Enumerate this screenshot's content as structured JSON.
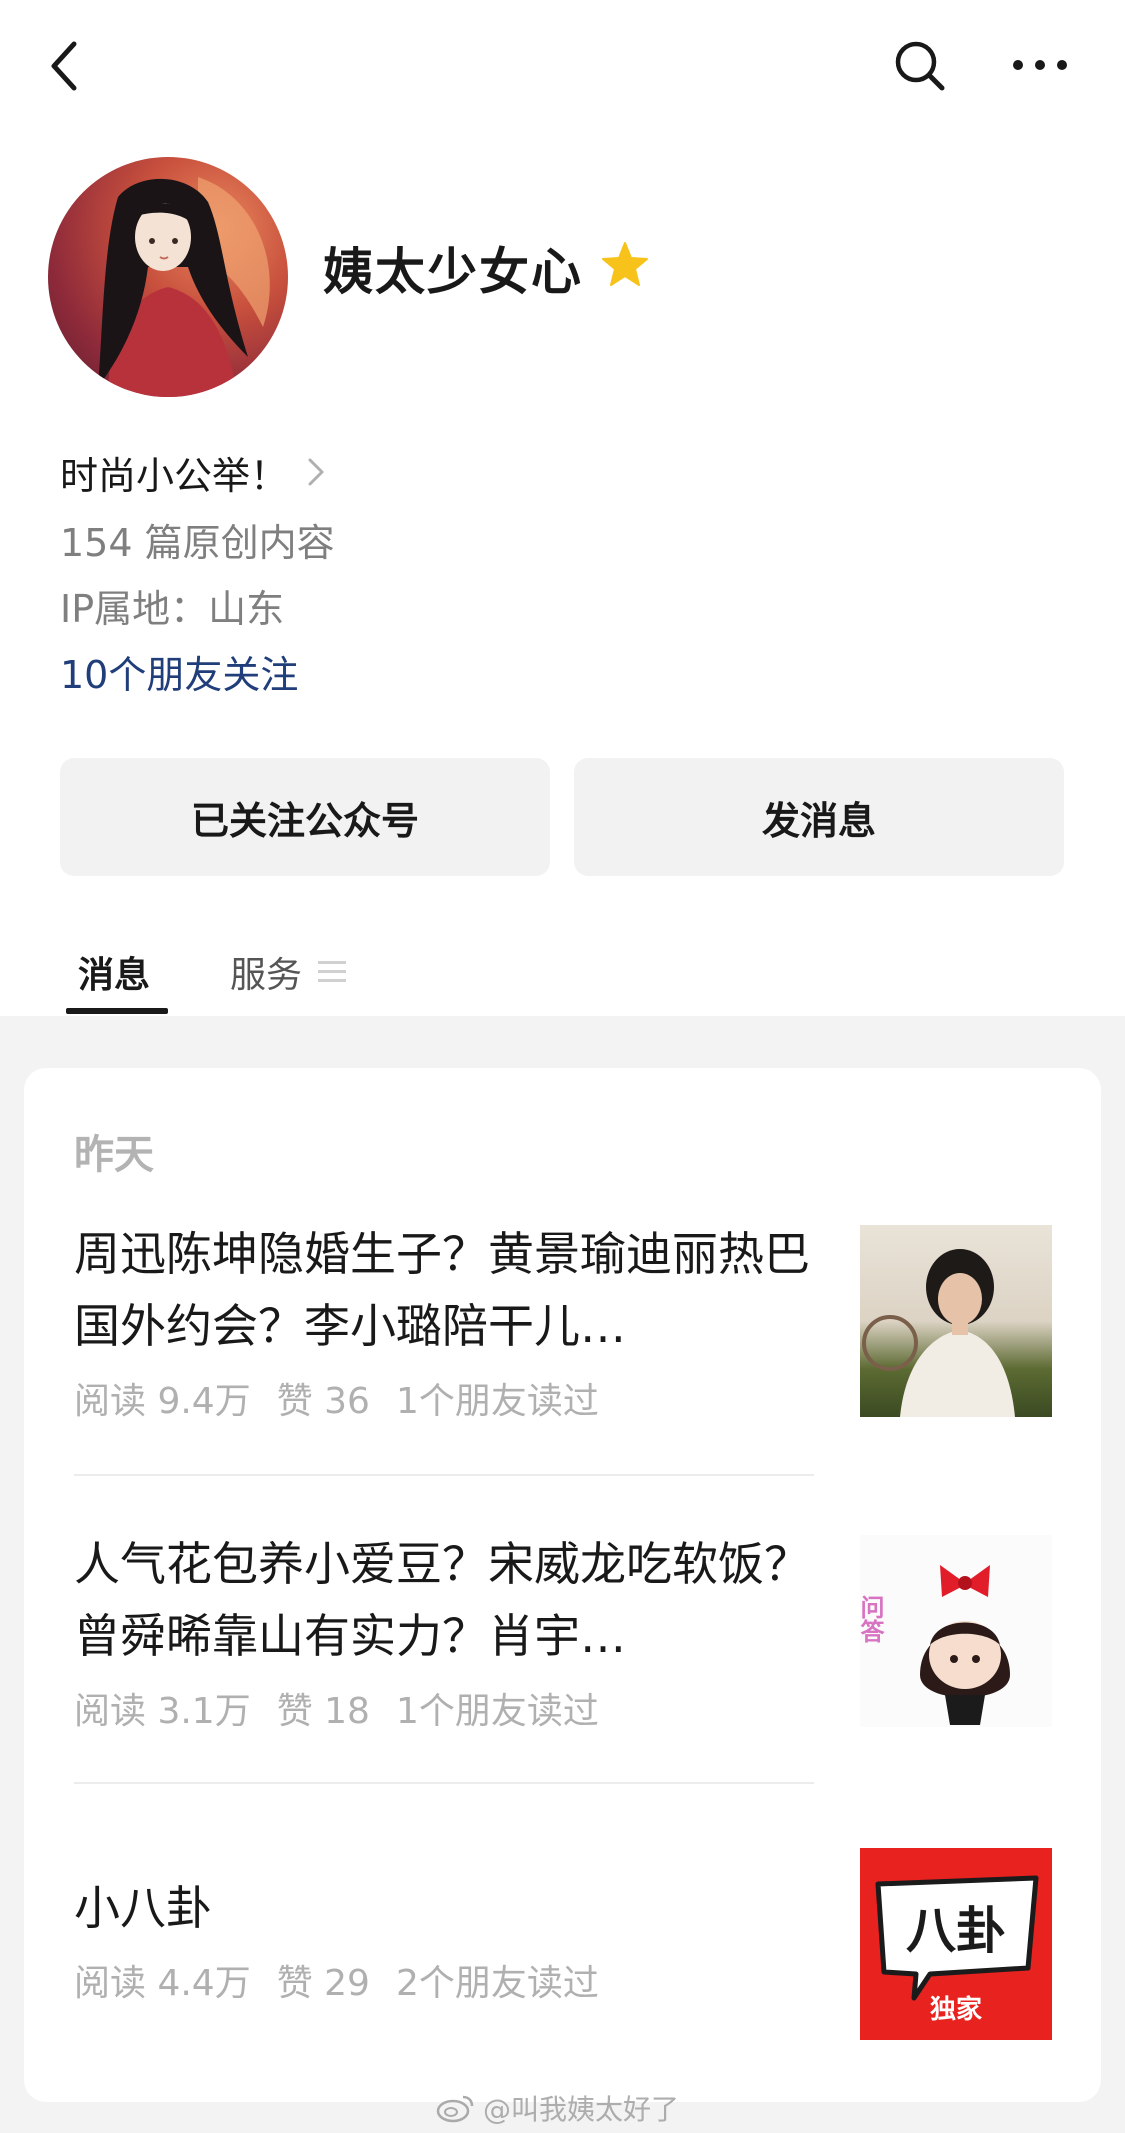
{
  "profile": {
    "name": "姨太少女心",
    "bio": "时尚小公举！",
    "original_count": "154 篇原创内容",
    "ip_location": "IP属地：山东",
    "friends_follow": "10个朋友关注"
  },
  "actions": {
    "follow_label": "已关注公众号",
    "message_label": "发消息"
  },
  "tabs": [
    {
      "label": "消息",
      "active": true
    },
    {
      "label": "服务",
      "active": false
    }
  ],
  "feed": {
    "date_label": "昨天",
    "articles": [
      {
        "title": "周迅陈坤隐婚生子？黄景瑜迪丽热巴国外约会？李小璐陪干儿…",
        "reads": "阅读 9.4万",
        "likes": "赞 36",
        "friends_read": "1个朋友读过"
      },
      {
        "title": "人气花包养小爱豆？宋威龙吃软饭？曾舜晞靠山有实力？肖宇…",
        "reads": "阅读 3.1万",
        "likes": "赞 18",
        "friends_read": "1个朋友读过"
      },
      {
        "title": "小八卦",
        "reads": "阅读 4.4万",
        "likes": "赞 29",
        "friends_read": "2个朋友读过"
      }
    ],
    "thumb2_text": "问答",
    "thumb3_main": "八卦",
    "thumb3_sub": "独家"
  },
  "watermark": "@叫我姨太好了",
  "colors": {
    "link": "#203e7a",
    "star": "#f7c21a",
    "badge_red": "#e8221f"
  }
}
